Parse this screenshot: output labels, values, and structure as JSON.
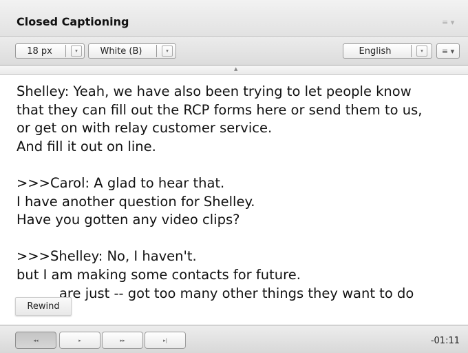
{
  "panel": {
    "title": "Closed Captioning",
    "title_menu_icon": "≡ ▾"
  },
  "toolbar": {
    "font_size": {
      "value": "18 px",
      "arrow": "▾"
    },
    "color": {
      "value": "White (B)",
      "arrow": "▾"
    },
    "language": {
      "value": "English",
      "arrow": "▾"
    },
    "menu_icon": "≡ ▾"
  },
  "grip": {
    "arrow": "▲"
  },
  "captions": {
    "lines": [
      "Shelley: Yeah, we have also been trying to let people know",
      "that they can fill out the RCP forms here or send them to us,",
      "or get on with relay customer service.",
      "And fill it out on line.",
      "",
      ">>>Carol: A glad to hear that.",
      "I have another question for Shelley.",
      "Have you gotten any video clips?",
      "",
      ">>>Shelley: No, I haven't.",
      "but I am making some contacts for future.",
      "          are just -- got too many other things they want to do"
    ]
  },
  "tooltip": {
    "label": "Rewind"
  },
  "transport": {
    "rewind_icon": "◂◂",
    "play_icon": "▸",
    "fast_forward_icon": "▸▸",
    "skip_end_icon": "▸|",
    "time_remaining": "-01:11"
  }
}
